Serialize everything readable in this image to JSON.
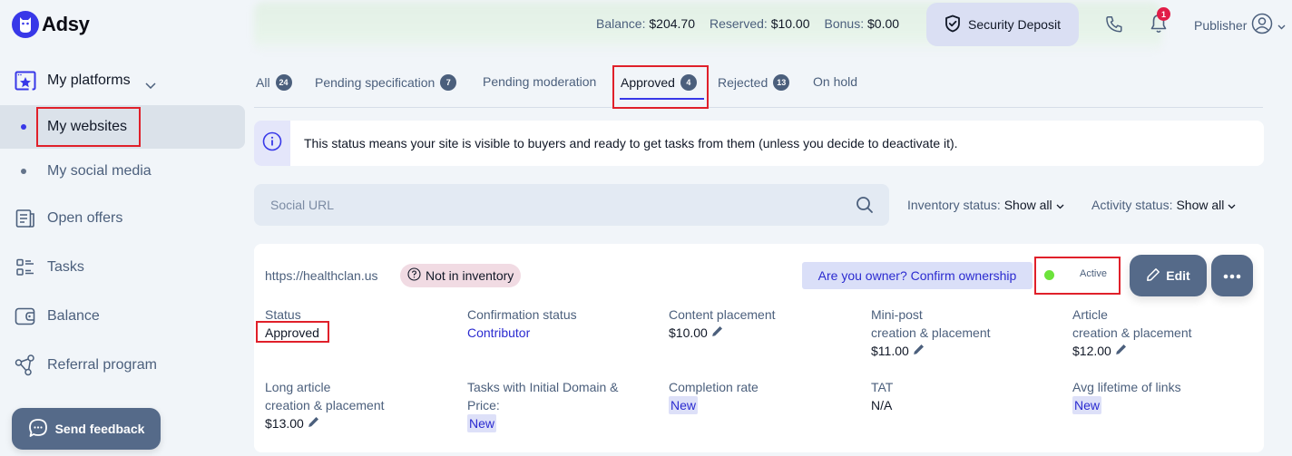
{
  "app": {
    "name": "Adsy"
  },
  "header": {
    "balance_label": "Balance:",
    "balance_value": "$204.70",
    "reserved_label": "Reserved:",
    "reserved_value": "$10.00",
    "bonus_label": "Bonus:",
    "bonus_value": "$0.00",
    "security_deposit_label": "Security Deposit",
    "notification_count": "1",
    "role_label": "Publisher"
  },
  "sidebar": {
    "items": [
      {
        "label": "My platforms",
        "icon": "star-window-icon"
      },
      {
        "label": "My websites",
        "active": true
      },
      {
        "label": "My social media"
      },
      {
        "label": "Open offers",
        "icon": "document-icon"
      },
      {
        "label": "Tasks",
        "icon": "tasks-list-icon"
      },
      {
        "label": "Balance",
        "icon": "wallet-icon"
      },
      {
        "label": "Referral program",
        "icon": "share-icon"
      }
    ],
    "feedback_label": "Send feedback"
  },
  "tabs": [
    {
      "label": "All",
      "count": "24"
    },
    {
      "label": "Pending specification",
      "count": "7"
    },
    {
      "label": "Pending moderation",
      "count": null
    },
    {
      "label": "Approved",
      "count": "4",
      "active": true
    },
    {
      "label": "Rejected",
      "count": "13"
    },
    {
      "label": "On hold",
      "count": null
    }
  ],
  "info_banner": {
    "text": "This status means your site is visible to buyers and ready to get tasks from them (unless you decide to deactivate it)."
  },
  "search": {
    "placeholder": "Social URL",
    "value": ""
  },
  "filters": {
    "inventory_label": "Inventory status:",
    "inventory_value": "Show all",
    "activity_label": "Activity status:",
    "activity_value": "Show all"
  },
  "card": {
    "url": "https://healthclan.us",
    "inventory_badge": "Not in inventory",
    "confirm_ownership": "Are you owner? Confirm ownership",
    "active_label": "Active",
    "active_color": "#6ce33b",
    "edit_label": "Edit",
    "fields": {
      "status": {
        "label": "Status",
        "value": "Approved"
      },
      "confirmation": {
        "label": "Confirmation status",
        "value": "Contributor"
      },
      "content_placement": {
        "label": "Content placement",
        "value": "$10.00"
      },
      "mini_post": {
        "label1": "Mini-post",
        "label2": "creation & placement",
        "value": "$11.00"
      },
      "article": {
        "label1": "Article",
        "label2": "creation & placement",
        "value": "$12.00"
      },
      "long_article": {
        "label1": "Long article",
        "label2": "creation & placement",
        "value": "$13.00"
      },
      "initial_domain": {
        "label1": "Tasks with Initial Domain &",
        "label2": "Price:",
        "value": "New"
      },
      "completion_rate": {
        "label": "Completion rate",
        "value": "New"
      },
      "tat": {
        "label": "TAT",
        "value": "N/A"
      },
      "avg_lifetime": {
        "label": "Avg lifetime of links",
        "value": "New"
      }
    }
  }
}
